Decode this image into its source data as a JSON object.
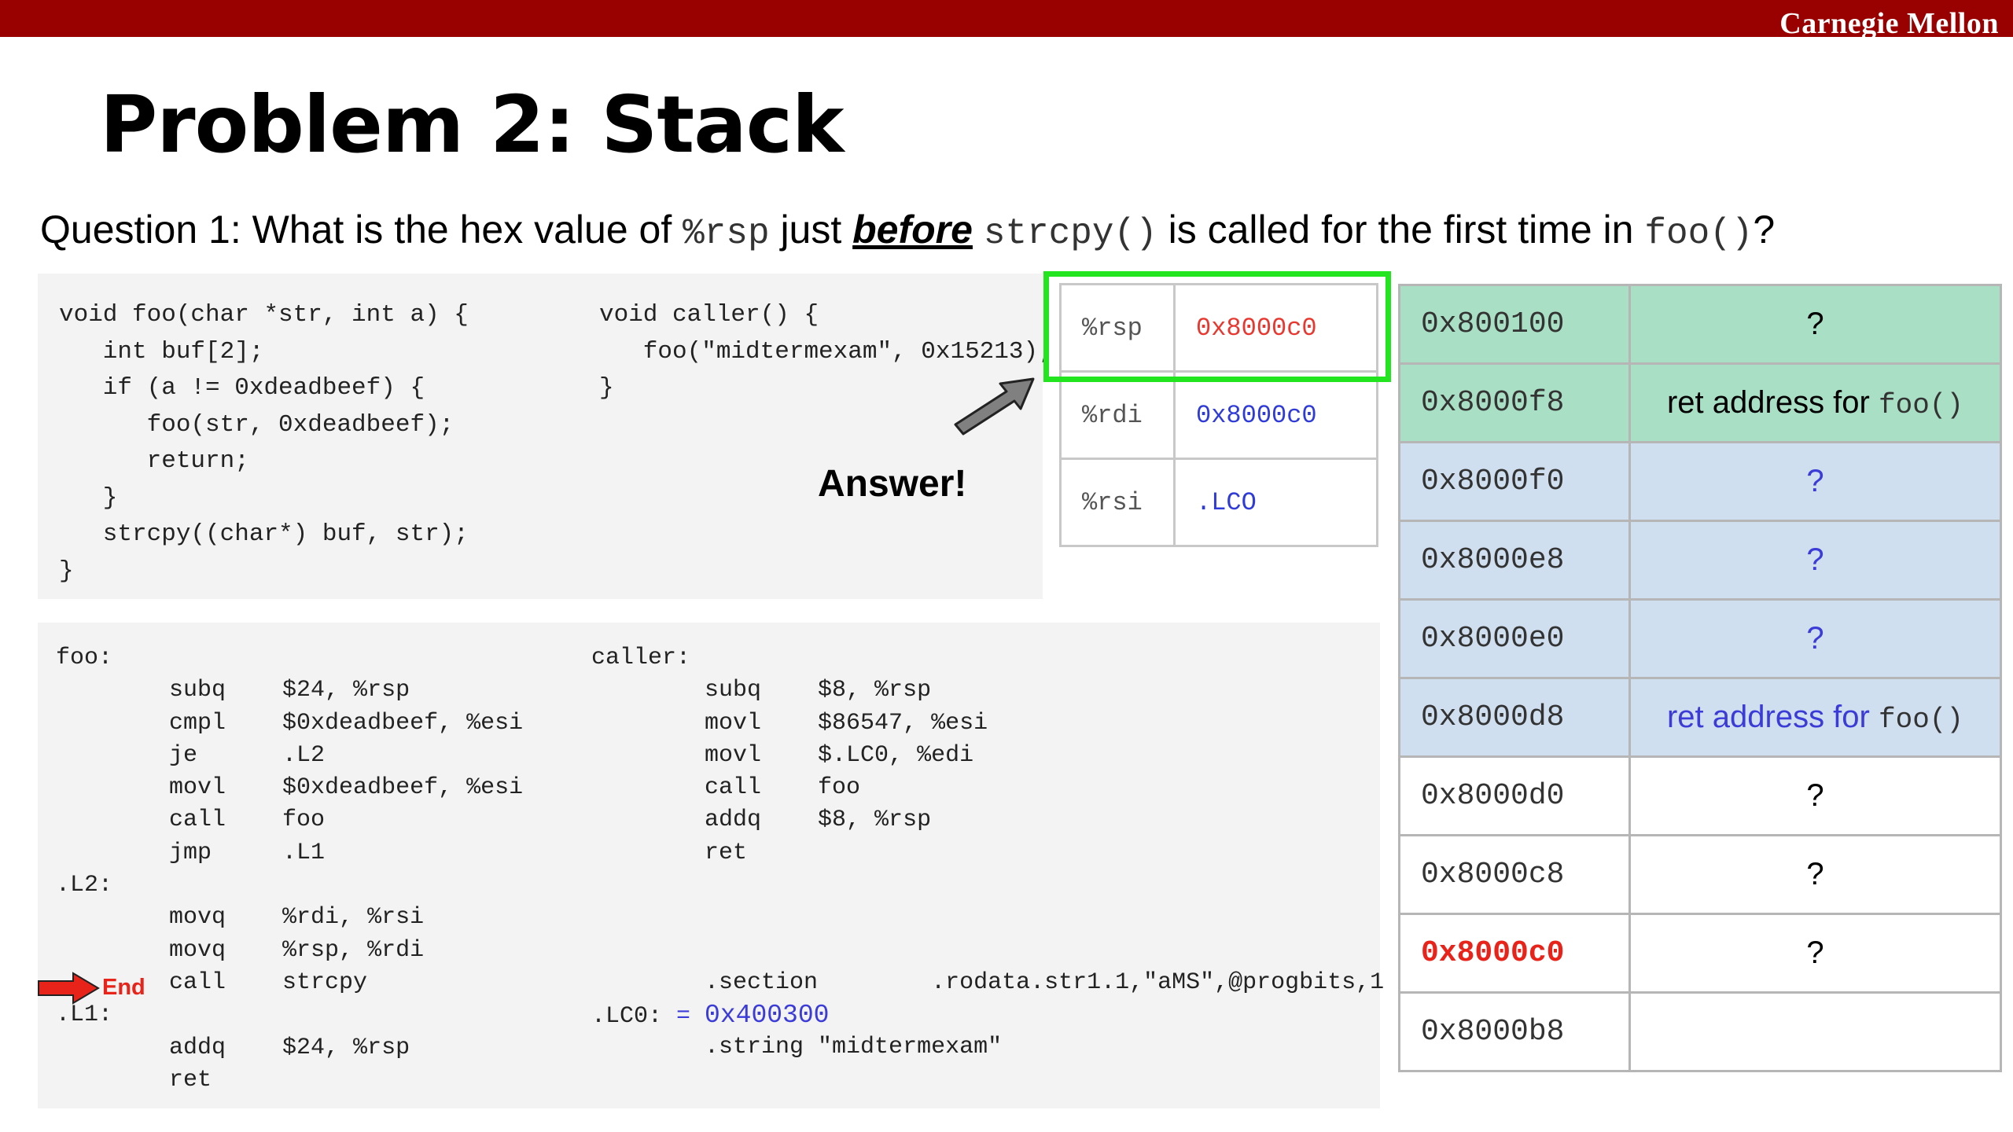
{
  "header": {
    "brand": "Carnegie Mellon",
    "accent": "#990000"
  },
  "title": "Problem 2: Stack",
  "question": {
    "prefix": "Question 1: What is the hex value of ",
    "reg": "%rsp",
    "mid1": " just ",
    "emph": "before",
    "func": "strcpy()",
    "mid2": " is called for the first time in ",
    "func2": "foo()",
    "suffix": "?"
  },
  "c_source": {
    "foo": [
      "void foo(char *str, int a) {",
      "   int buf[2];",
      "   if (a != 0xdeadbeef) {",
      "      foo(str, 0xdeadbeef);",
      "      return;",
      "   }",
      "   strcpy((char*) buf, str);",
      "}"
    ],
    "caller": [
      "void caller() {",
      "   foo(\"midtermexam\", 0x15213);",
      "}"
    ]
  },
  "asm": {
    "foo": [
      "foo:",
      "        subq    $24, %rsp",
      "        cmpl    $0xdeadbeef, %esi",
      "        je      .L2",
      "        movl    $0xdeadbeef, %esi",
      "        call    foo",
      "        jmp     .L1",
      ".L2:",
      "        movq    %rdi, %rsi",
      "        movq    %rsp, %rdi",
      "        call    strcpy",
      ".L1:",
      "        addq    $24, %rsp",
      "        ret"
    ],
    "caller": [
      "caller:",
      "        subq    $8, %rsp",
      "        movl    $86547, %esi",
      "        movl    $.LC0, %edi",
      "        call    foo",
      "        addq    $8, %rsp",
      "        ret",
      "",
      "",
      "",
      "        .section        .rodata.str1.1,\"aMS\",@progbits,1"
    ],
    "lc0_label": ".LC0:",
    "lc0_eq": " = ",
    "lc0_addr": "0x400300",
    "string_line": "        .string \"midtermexam\""
  },
  "end_marker": {
    "label": "End"
  },
  "answer_label": "Answer!",
  "registers": [
    {
      "name": "%rsp",
      "value": "0x8000c0"
    },
    {
      "name": "%rdi",
      "value": "0x8000c0"
    },
    {
      "name": "%rsi",
      "value": ".LCO"
    }
  ],
  "stack": [
    {
      "addr": "0x800100",
      "content": "?",
      "color": "green"
    },
    {
      "addr": "0x8000f8",
      "content": "ret address for ",
      "func": "foo()",
      "color": "green"
    },
    {
      "addr": "0x8000f0",
      "content": "?",
      "color": "blue"
    },
    {
      "addr": "0x8000e8",
      "content": "?",
      "color": "blue"
    },
    {
      "addr": "0x8000e0",
      "content": "?",
      "color": "blue"
    },
    {
      "addr": "0x8000d8",
      "content": "ret address for ",
      "func": "foo()",
      "color": "blue"
    },
    {
      "addr": "0x8000d0",
      "content": "?",
      "color": "white"
    },
    {
      "addr": "0x8000c8",
      "content": "?",
      "color": "white"
    },
    {
      "addr": "0x8000c0",
      "content": "?",
      "color": "white",
      "current": true
    },
    {
      "addr": "0x8000b8",
      "content": "",
      "color": "white"
    }
  ],
  "colors": {
    "highlight_box": "#22e51f",
    "stack_green": "#a9dfc4",
    "stack_blue": "#cfdfef",
    "red_text": "#e8231a",
    "blue_text": "#2f3bd8"
  }
}
